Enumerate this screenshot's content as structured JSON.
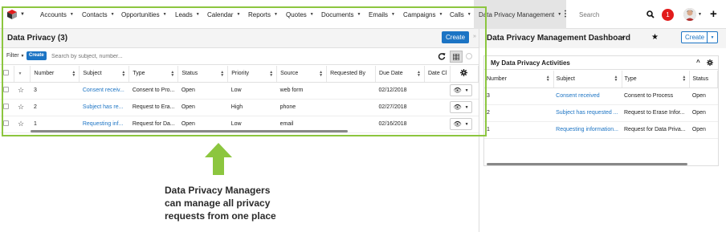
{
  "nav": {
    "logo_icon": "sugar-cube-logo-icon",
    "items": [
      {
        "label": "Accounts"
      },
      {
        "label": "Contacts"
      },
      {
        "label": "Opportunities"
      },
      {
        "label": "Leads"
      },
      {
        "label": "Calendar"
      },
      {
        "label": "Reports"
      },
      {
        "label": "Quotes"
      },
      {
        "label": "Documents"
      },
      {
        "label": "Emails"
      },
      {
        "label": "Campaigns"
      },
      {
        "label": "Calls"
      }
    ],
    "active_item": "Data Privacy Management",
    "search_placeholder": "Search",
    "notification_count": "1"
  },
  "list": {
    "title": "Data Privacy (3)",
    "create_label": "Create",
    "filter_label": "Filter",
    "filter_create_label": "Create",
    "search_placeholder": "Search by subject, number...",
    "columns": [
      "Number",
      "Subject",
      "Type",
      "Status",
      "Priority",
      "Source",
      "Requested By",
      "Due Date",
      "Date Cl"
    ],
    "rows": [
      {
        "number": "3",
        "subject": "Consent receiv...",
        "type": "Consent to Pro...",
        "status": "Open",
        "priority": "Low",
        "source": "web form",
        "requested_by": "",
        "due_date": "02/12/2018",
        "date_closed": ""
      },
      {
        "number": "2",
        "subject": "Subject has re...",
        "type": "Request to Era...",
        "status": "Open",
        "priority": "High",
        "source": "phone",
        "requested_by": "",
        "due_date": "02/27/2018",
        "date_closed": ""
      },
      {
        "number": "1",
        "subject": "Requesting inf...",
        "type": "Request for Da...",
        "status": "Open",
        "priority": "Low",
        "source": "email",
        "requested_by": "",
        "due_date": "02/16/2018",
        "date_closed": ""
      }
    ]
  },
  "dashboard": {
    "title": "Data Privacy Management Dashboard",
    "create_label": "Create",
    "dashlet_title": "My Data Privacy Activities",
    "columns": [
      "Number",
      "Subject",
      "Type",
      "Status"
    ],
    "rows": [
      {
        "number": "3",
        "subject": "Consent received",
        "type": "Consent to Process",
        "status": "Open"
      },
      {
        "number": "2",
        "subject": "Subject has requested ...",
        "type": "Request to Erase Infor...",
        "status": "Open"
      },
      {
        "number": "1",
        "subject": "Requesting information...",
        "type": "Request for Data Priva...",
        "status": "Open"
      }
    ]
  },
  "callout": {
    "line1": "Data Privacy Managers",
    "line2": "can manage all privacy",
    "line3": "requests from one place"
  },
  "colors": {
    "accent_blue": "#1c74c4",
    "highlight_green": "#8cc63f",
    "arrow_green": "#8cc63f",
    "notification_red": "#e21b1b"
  }
}
